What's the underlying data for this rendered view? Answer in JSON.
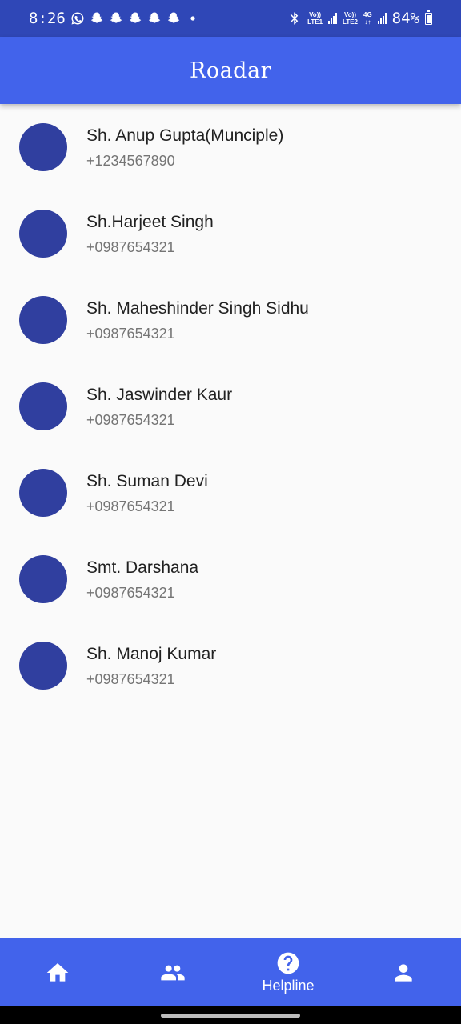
{
  "status_bar": {
    "time": "8:26",
    "left_icons": [
      "whatsapp-icon",
      "snapchat-icon",
      "snapchat-icon",
      "snapchat-icon",
      "snapchat-icon",
      "snapchat-icon",
      "dot-icon"
    ],
    "volte1": "Vo))",
    "lte1": "LTE1",
    "volte2": "Vo))",
    "lte2": "LTE2",
    "network": "4G",
    "battery_percent": "84%"
  },
  "app_bar": {
    "title": "Roadar"
  },
  "contacts": [
    {
      "name": "Sh. Anup Gupta(Munciple)",
      "phone": "+1234567890"
    },
    {
      "name": "Sh.Harjeet Singh",
      "phone": "+0987654321"
    },
    {
      "name": "Sh. Maheshinder Singh Sidhu",
      "phone": "+0987654321"
    },
    {
      "name": "Sh. Jaswinder Kaur",
      "phone": "+0987654321"
    },
    {
      "name": "Sh. Suman Devi",
      "phone": "+0987654321"
    },
    {
      "name": "Smt. Darshana",
      "phone": "+0987654321"
    },
    {
      "name": "Sh. Manoj Kumar",
      "phone": "+0987654321"
    }
  ],
  "bottom_nav": {
    "items": [
      {
        "icon": "home-icon",
        "label": ""
      },
      {
        "icon": "people-icon",
        "label": ""
      },
      {
        "icon": "help-circle-icon",
        "label": "Helpline"
      },
      {
        "icon": "person-icon",
        "label": ""
      }
    ]
  },
  "colors": {
    "status_bar": "#2f47b7",
    "app_bar": "#4263eb",
    "avatar": "#303f9f",
    "background": "#fafafa"
  }
}
